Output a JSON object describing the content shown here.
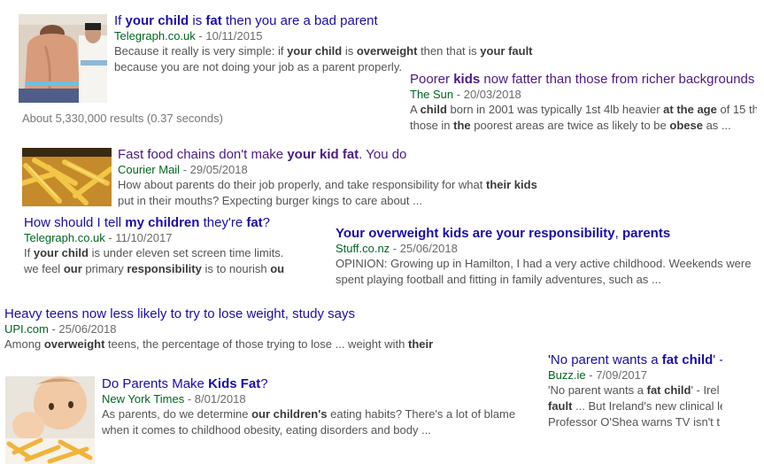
{
  "results_stats": "About 5,330,000 results (0.37 seconds)",
  "sep": " - ",
  "results": [
    {
      "title": [
        "If ",
        "your child",
        " is ",
        "fat",
        " then you are a bad parent"
      ],
      "source": "Telegraph.co.uk",
      "date": "10/11/2015",
      "lines": [
        [
          "Because it really is very simple: if ",
          "your child",
          " is ",
          "overweight",
          " then that is ",
          "your fault"
        ],
        [
          "because you are not doing your job as a parent properly."
        ]
      ],
      "thumb": "shirtless-boy-with-tape-measure"
    },
    {
      "title": [
        "Poorer ",
        "kids",
        " now fatter than those from richer backgrounds"
      ],
      "source": "The Sun",
      "date": "20/03/2018",
      "lines": [
        [
          "A ",
          "child",
          " born in 2001 was typically 1st 4lb heavier ",
          "at the age",
          " of 15 th"
        ],
        [
          "those in ",
          "the",
          " poorest areas are twice as likely to be ",
          "obese",
          " as ..."
        ]
      ]
    },
    {
      "title": [
        "Fast food chains don't make ",
        "your kid fat",
        ". You do"
      ],
      "source": "Courier Mail",
      "date": "29/05/2018",
      "lines": [
        [
          "How about parents do their job properly, and take responsibility for what ",
          "their kids"
        ],
        [
          "put in their mouths? Expecting burger kings to care about ..."
        ]
      ],
      "thumb": "french-fries"
    },
    {
      "title": [
        "How should I tell ",
        "my children",
        " they're ",
        "fat",
        "?"
      ],
      "source": "Telegraph.co.uk",
      "date": "11/10/2017",
      "lines": [
        [
          "If ",
          "your child",
          " is under eleven set screen time limits."
        ],
        [
          "we feel ",
          "our",
          " primary ",
          "responsibility",
          " is to nourish ",
          "ou"
        ]
      ]
    },
    {
      "title": [
        "",
        "Your overweight kids are your responsibility",
        ", ",
        "parents"
      ],
      "source": "Stuff.co.nz",
      "date": "25/06/2018",
      "lines": [
        [
          "OPINION: Growing up in Hamilton, I had a very active childhood. Weekends were"
        ],
        [
          "spent playing football and fitting in family adventures, such as ..."
        ]
      ]
    },
    {
      "title": [
        "Heavy teens now less likely to try to lose weight, study says"
      ],
      "source": "UPI.com",
      "date": "25/06/2018",
      "lines": [
        [
          "Among ",
          "overweight",
          " teens, the percentage of those trying to lose ... weight with ",
          "their"
        ]
      ]
    },
    {
      "title": [
        "'No parent wants a ",
        "fat child",
        "' -"
      ],
      "source": "Buzz.ie",
      "date": "7/09/2017",
      "lines": [
        [
          "'No parent wants a ",
          "fat child",
          "' - Irel"
        ],
        [
          "",
          "fault",
          " ... But Ireland's new clinical le"
        ],
        [
          "Professor O'Shea warns TV isn't t"
        ]
      ]
    },
    {
      "title": [
        "Do Parents Make ",
        "Kids Fat",
        "?"
      ],
      "source": "New York Times",
      "date": "8/01/2018",
      "lines": [
        [
          "As parents, do we determine ",
          "our children's",
          " eating habits? There's a lot of blame"
        ],
        [
          "when it comes to childhood obesity, eating disorders and body ..."
        ]
      ],
      "thumb": "toddler-eating-fries"
    }
  ]
}
